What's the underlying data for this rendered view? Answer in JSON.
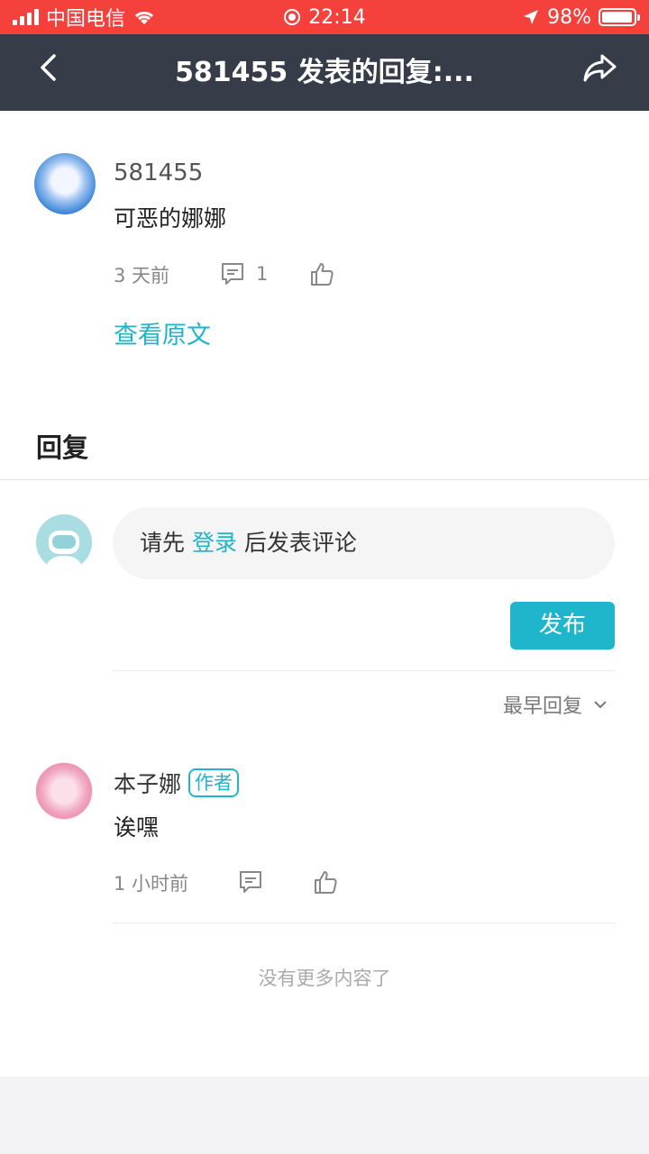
{
  "status_bar": {
    "carrier": "中国电信",
    "time": "22:14",
    "battery": "98%",
    "battery_level": 0.98
  },
  "nav": {
    "title": "581455 发表的回复:..."
  },
  "post": {
    "author": "581455",
    "content": "可恶的娜娜",
    "time": "3 天前",
    "comment_count": "1",
    "view_original": "查看原文"
  },
  "replies_section": {
    "title": "回复"
  },
  "comment_input": {
    "prefix": "请先 ",
    "login": "登录",
    "suffix": " 后发表评论"
  },
  "publish_button": "发布",
  "sort": {
    "label": "最早回复"
  },
  "reply": {
    "author": "本子娜",
    "badge": "作者",
    "content": "诶嘿",
    "time": "1 小时前"
  },
  "footer": {
    "no_more": "没有更多内容了"
  },
  "colors": {
    "status_bar": "#f5413b",
    "nav_bar": "#363c48",
    "accent": "#1fb6cc"
  }
}
